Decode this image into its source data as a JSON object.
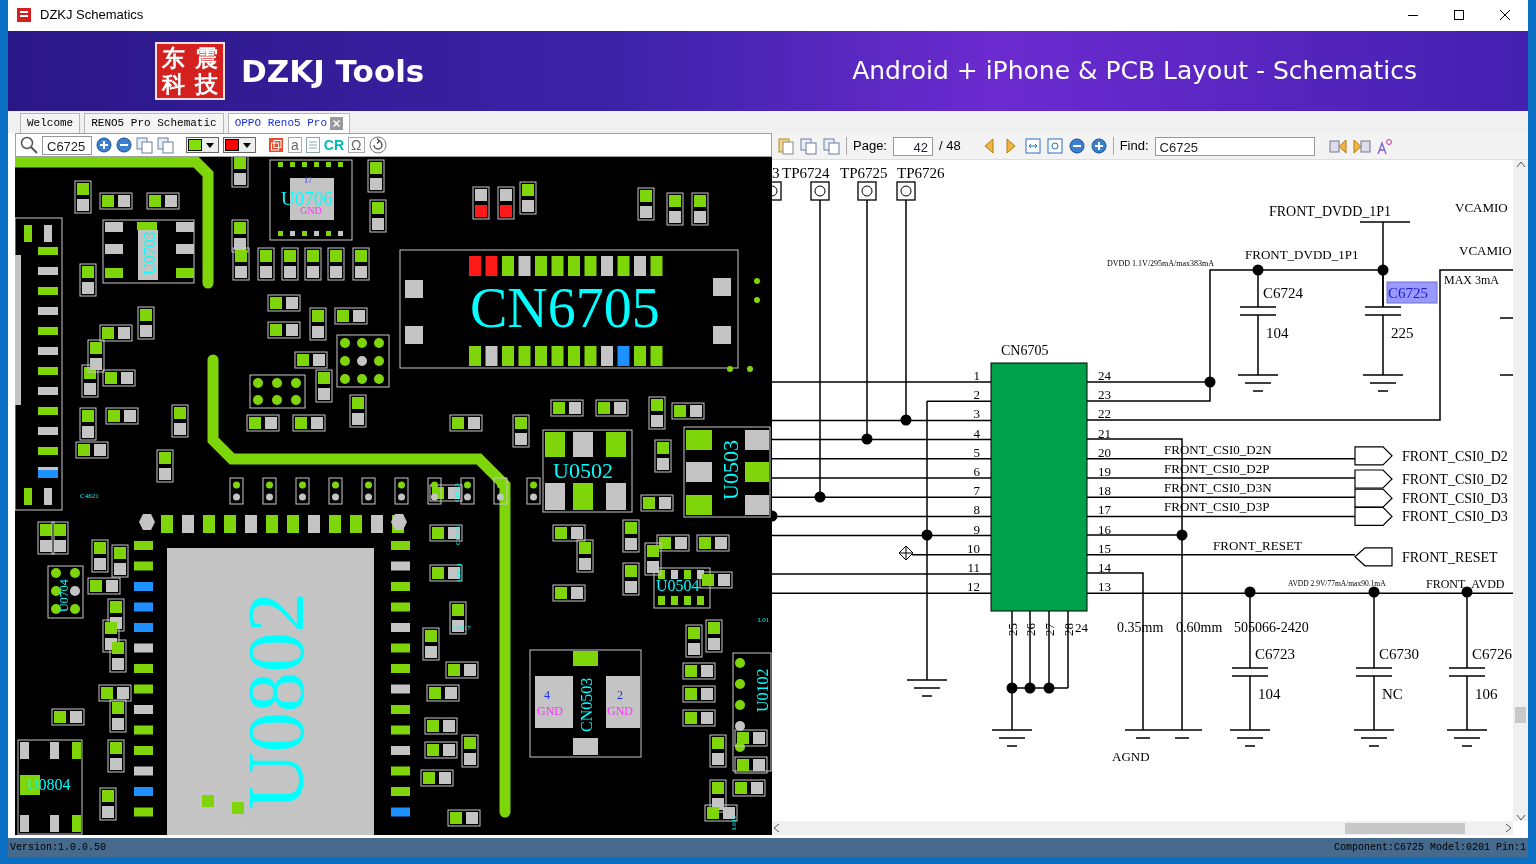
{
  "window": {
    "title": "DZKJ Schematics"
  },
  "banner": {
    "logo_chars": [
      "东",
      "震",
      "科",
      "技"
    ],
    "brand": "DZKJ Tools",
    "tagline": "Android + iPhone & PCB Layout - Schematics"
  },
  "tabs": [
    {
      "label": "Welcome",
      "selected": false,
      "closable": false
    },
    {
      "label": "RENO5 Pro Schematic",
      "selected": false,
      "closable": false
    },
    {
      "label": "OPPO Reno5 Pro",
      "selected": true,
      "closable": true
    }
  ],
  "pcb_toolbar": {
    "search_value": "C6725",
    "colors": [
      {
        "color": "#80e000"
      },
      {
        "color": "#ff0000"
      }
    ],
    "text_tools": [
      "a",
      "CR",
      "Ω"
    ]
  },
  "pcb": {
    "labels": [
      {
        "text": "17",
        "kind": "pin"
      },
      {
        "text": "U0706",
        "kind": "chip"
      },
      {
        "text": "GND",
        "kind": "net"
      },
      {
        "text": "U0703",
        "kind": "chip"
      },
      {
        "text": "CN6705",
        "kind": "chip"
      },
      {
        "text": "U0502",
        "kind": "chip"
      },
      {
        "text": "U0503",
        "kind": "chip"
      },
      {
        "text": "C4621",
        "kind": "chip"
      },
      {
        "text": "C0833",
        "kind": "chip"
      },
      {
        "text": "C0816",
        "kind": "chip"
      },
      {
        "text": "U0801",
        "kind": "chip"
      },
      {
        "text": "C0817",
        "kind": "chip"
      },
      {
        "text": "U0704",
        "kind": "chip"
      },
      {
        "text": "U0504",
        "kind": "chip"
      },
      {
        "text": "L01",
        "kind": "chip"
      },
      {
        "text": "U0102",
        "kind": "chip"
      },
      {
        "text": "4",
        "kind": "pin"
      },
      {
        "text": "GND",
        "kind": "net"
      },
      {
        "text": "CN0503",
        "kind": "chip"
      },
      {
        "text": "2",
        "kind": "pin"
      },
      {
        "text": "GND",
        "kind": "net"
      },
      {
        "text": "U0802",
        "kind": "chip"
      },
      {
        "text": "U0804",
        "kind": "chip"
      },
      {
        "text": "L011",
        "kind": "chip"
      }
    ]
  },
  "schematic_toolbar": {
    "page_label": "Page:",
    "page_value": "42",
    "page_total": "/ 48",
    "find_label": "Find:",
    "find_value": "C6725"
  },
  "schematic": {
    "test_points": [
      "3",
      "TP6724",
      "TP6725",
      "TP6726"
    ],
    "connector": {
      "ref": "CN6705",
      "left_pins": [
        "1",
        "2",
        "3",
        "4",
        "5",
        "6",
        "7",
        "8",
        "9",
        "10",
        "11",
        "12"
      ],
      "right_pins": [
        "24",
        "23",
        "22",
        "21",
        "20",
        "19",
        "18",
        "17",
        "16",
        "15",
        "14",
        "13"
      ],
      "bottom_pins": [
        "25",
        "26",
        "27",
        "28",
        "24"
      ]
    },
    "net_labels": [
      "FRONT_DVDD_1P1",
      "VCAMIO",
      "DVDD 1.1V/295mA/max383mA",
      "FRONT_DVDD_1P1",
      "VCAMIO",
      "MAX 3mA",
      "FRONT_CSI0_D2N",
      "FRONT_CSI0_D2P",
      "FRONT_CSI0_D3N",
      "FRONT_CSI0_D3P",
      "FRONT_RESET",
      "AVDD 2.9V/77mA/max90.1mA",
      "FRONT_AVDD",
      "0.35mm",
      "0.60mm",
      "505066-2420",
      "AGND"
    ],
    "ports": [
      {
        "text": "FRONT_CSI0_D2",
        "kind": "output"
      },
      {
        "text": "FRONT_CSI0_D2",
        "kind": "output"
      },
      {
        "text": "FRONT_CSI0_D3",
        "kind": "output"
      },
      {
        "text": "FRONT_CSI0_D3",
        "kind": "output"
      },
      {
        "text": "FRONT_RESET",
        "kind": "input"
      }
    ],
    "capacitors": [
      {
        "ref": "C6724",
        "value": "104",
        "selected": false
      },
      {
        "ref": "C6725",
        "value": "225",
        "selected": true
      },
      {
        "ref": "C6723",
        "value": "104",
        "selected": false
      },
      {
        "ref": "C6730",
        "value": "NC",
        "selected": false
      },
      {
        "ref": "C6726",
        "value": "106",
        "selected": false
      }
    ]
  },
  "status_bar": {
    "version": "Version:1.0.0.50",
    "component": "Component:C6725 Model:0201 Pin:1"
  }
}
